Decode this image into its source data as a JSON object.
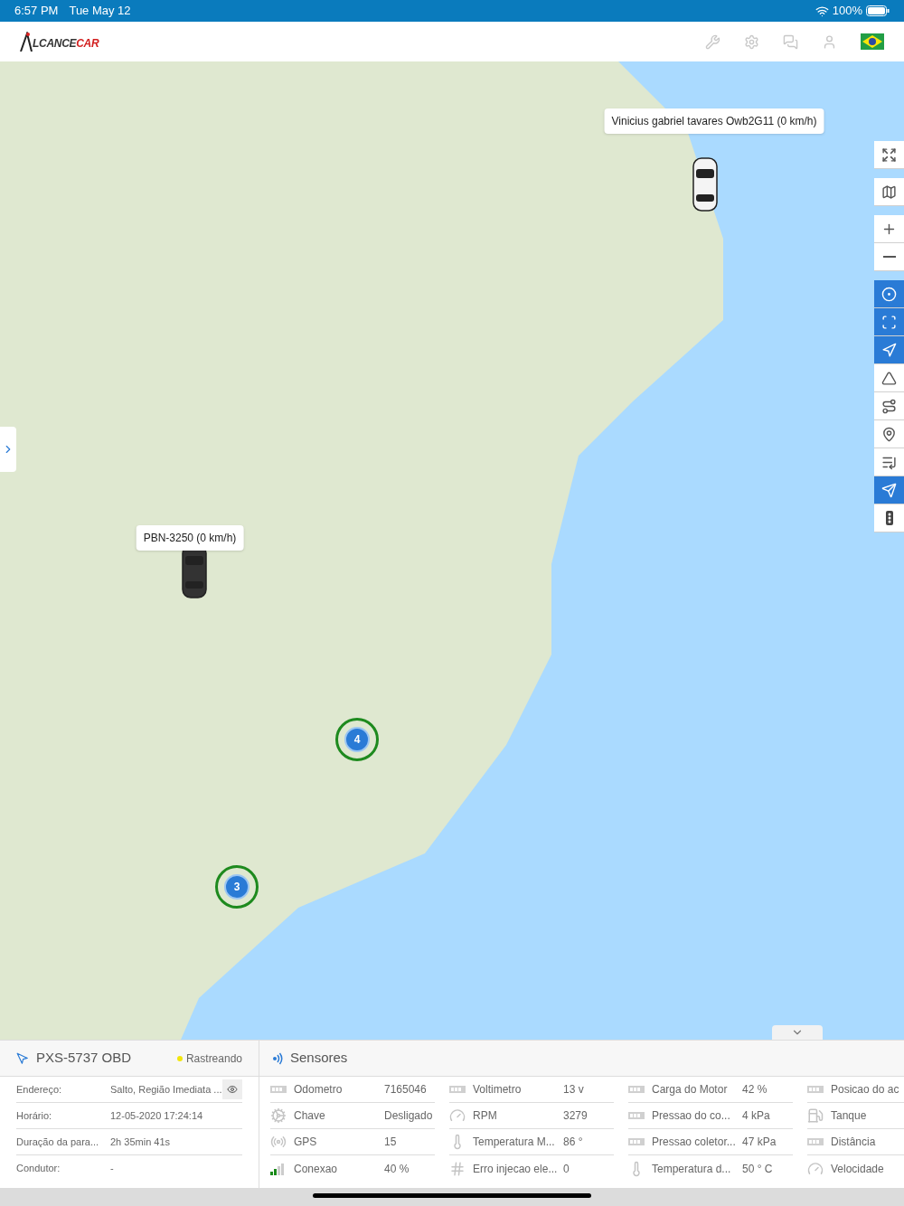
{
  "status_bar": {
    "time": "6:57 PM",
    "date": "Tue May 12",
    "battery": "100%"
  },
  "header": {
    "logo": {
      "prefix": "LCANCE",
      "suffix": "CAR"
    }
  },
  "map": {
    "markers": [
      {
        "label": "Vinicius gabriel tavares Owb2G11 (0 km/h)"
      },
      {
        "label": "PBN-3250 (0 km/h)"
      }
    ],
    "clusters": [
      {
        "count": "4"
      },
      {
        "count": "3"
      }
    ]
  },
  "toolbar": [
    [
      {
        "active": false
      }
    ],
    [
      {
        "active": false
      }
    ],
    [
      {
        "active": false
      },
      {
        "active": false
      }
    ],
    [
      {
        "active": true
      },
      {
        "active": true
      },
      {
        "active": true
      },
      {
        "active": false
      },
      {
        "active": false
      },
      {
        "active": false
      },
      {
        "active": false
      },
      {
        "active": true
      },
      {
        "active": false
      }
    ]
  ],
  "vehicle": {
    "title": "PXS-5737 OBD",
    "status": {
      "label": "Rastreando",
      "color": "#f2e60c"
    },
    "rows": [
      {
        "label": "Endereço:",
        "value": "Salto, Região Imediata ...",
        "view_button": true
      },
      {
        "label": "Horário:",
        "value": "12-05-2020 17:24:14",
        "view_button": false
      },
      {
        "label": "Duração da para...",
        "value": "2h 35min 41s",
        "view_button": false
      },
      {
        "label": "Condutor:",
        "value": "-",
        "view_button": false
      }
    ]
  },
  "sensors": {
    "title": "Sensores",
    "columns": [
      [
        {
          "kind": "meter",
          "label": "Odometro",
          "value": "7165046"
        },
        {
          "kind": "engine",
          "label": "Chave",
          "value": "Desligado"
        },
        {
          "kind": "gps",
          "label": "GPS",
          "value": "15"
        },
        {
          "kind": "signal",
          "label": "Conexao",
          "value": "40 %"
        }
      ],
      [
        {
          "kind": "meter",
          "label": "Voltimetro",
          "value": "13 v"
        },
        {
          "kind": "gauge",
          "label": "RPM",
          "value": "3279"
        },
        {
          "kind": "temp",
          "label": "Temperatura M...",
          "value": "86 °"
        },
        {
          "kind": "hash",
          "label": "Erro injecao ele...",
          "value": "0"
        }
      ],
      [
        {
          "kind": "meter",
          "label": "Carga do Motor",
          "value": "42 %"
        },
        {
          "kind": "meter",
          "label": "Pressao do co...",
          "value": "4 kPa"
        },
        {
          "kind": "meter",
          "label": "Pressao coletor...",
          "value": "47 kPa"
        },
        {
          "kind": "temp",
          "label": "Temperatura d...",
          "value": "50 ° C"
        }
      ],
      [
        {
          "kind": "meter",
          "label": "Posicao do ac"
        },
        {
          "kind": "fuel",
          "label": "Tanque"
        },
        {
          "kind": "meter",
          "label": "Distância"
        },
        {
          "kind": "gauge",
          "label": "Velocidade"
        }
      ]
    ]
  }
}
